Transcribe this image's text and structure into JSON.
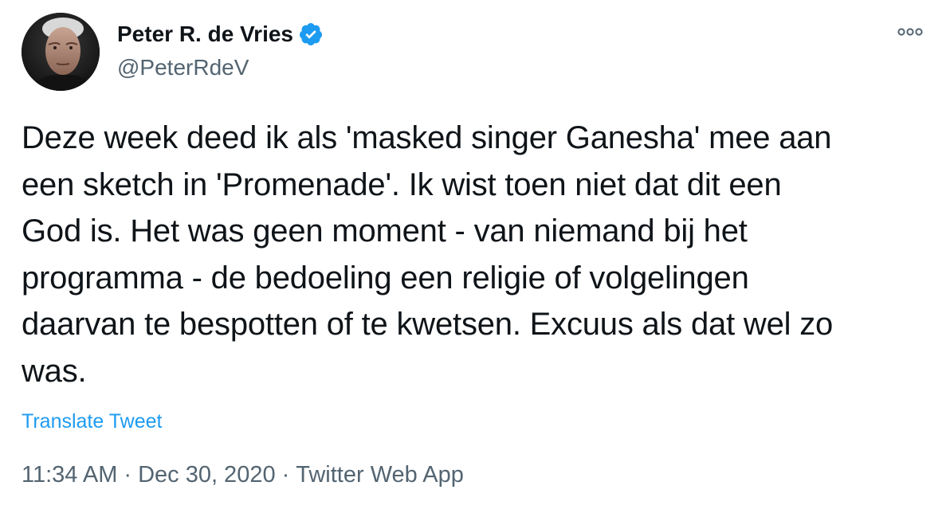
{
  "author": {
    "name": "Peter R. de Vries",
    "handle": "@PeterRdeV",
    "verified": true
  },
  "tweet": {
    "lines": [
      "Deze week deed ik als 'masked singer Ganesha' mee aan",
      "een sketch in 'Promenade'. Ik wist toen niet dat dit een",
      "God is. Het was geen moment - van niemand bij het",
      "programma - de bedoeling een religie of volgelingen",
      "daarvan te bespotten of te kwetsen. Excuus als dat wel zo",
      "was."
    ],
    "translate_label": "Translate Tweet"
  },
  "meta": {
    "time": "11:34 AM",
    "date": "Dec 30, 2020",
    "source": "Twitter Web App",
    "separator": "·"
  },
  "icons": {
    "verified": "verified-badge-icon",
    "more": "more-options-icon"
  },
  "colors": {
    "text": "#0f1419",
    "secondary": "#536471",
    "link": "#1d9bf0",
    "verified": "#1d9bf0"
  }
}
